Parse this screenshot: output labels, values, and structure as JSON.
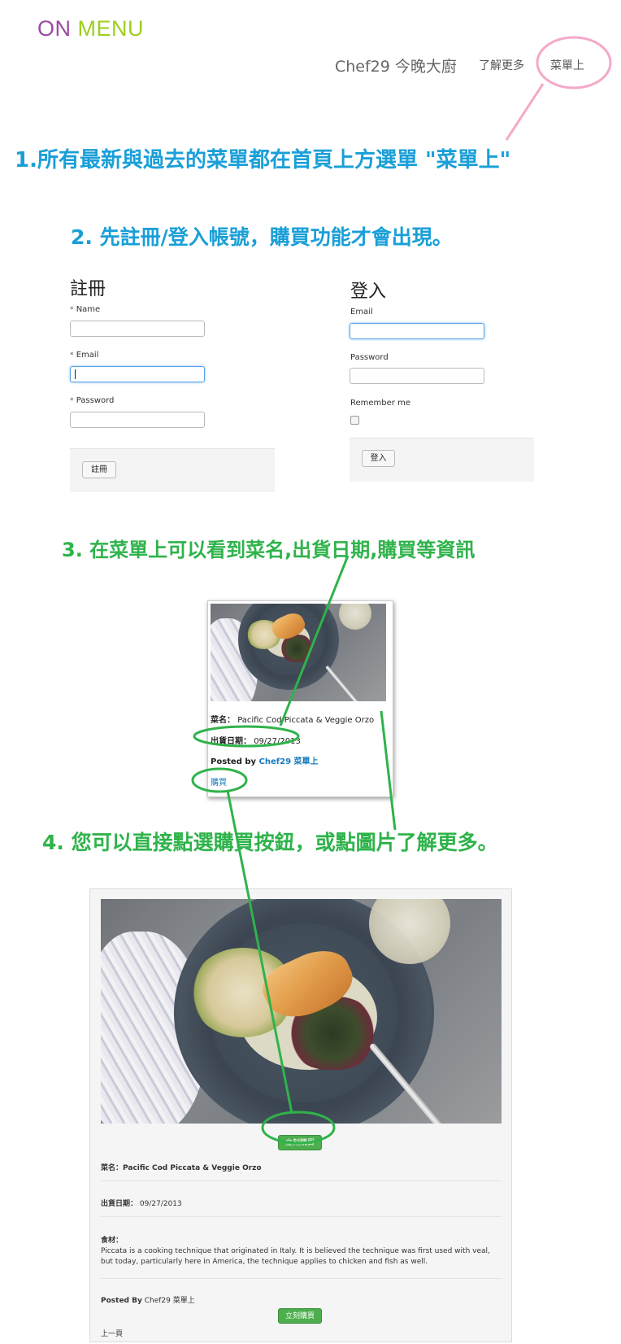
{
  "header": {
    "logo_on": "ON",
    "logo_menu": "MENU",
    "nav_brand": "Chef29 今晚大廚",
    "nav_about": "了解更多",
    "nav_menu": "菜單上"
  },
  "steps": {
    "step1": "1.所有最新與過去的菜單都在首頁上方選單 \"菜單上\"",
    "step2": "2. 先註冊/登入帳號，購買功能才會出現。",
    "step3": "3. 在菜單上可以看到菜名,出貨日期,購買等資訊",
    "step4": "4. 您可以直接點選購買按鈕，或點圖片了解更多。"
  },
  "register": {
    "title": "註冊",
    "name_label": "Name",
    "email_label": "Email",
    "password_label": "Password",
    "required_mark": "*",
    "submit": "註冊"
  },
  "login": {
    "title": "登入",
    "email_label": "Email",
    "password_label": "Password",
    "remember_label": "Remember me",
    "submit": "登入"
  },
  "card": {
    "name_label": "菜名：",
    "name_value": "Pacific Cod Piccata & Veggie Orzo",
    "date_label": "出貨日期：",
    "date_value": "09/27/2013",
    "posted_by": "Posted by",
    "author": "Chef29 菜單上",
    "buy_link": "購買"
  },
  "detail": {
    "buy_now": "立刻購買",
    "name_label": "菜名：",
    "name_value": "Pacific Cod Piccata & Veggie Orzo",
    "date_label": "出貨日期：",
    "date_value": "09/27/2013",
    "ingredients_label": "食材：",
    "description": "Piccata is a cooking technique that originated in Italy. It is believed the technique was first used with veal, but today, particularly here in America, the technique applies to chicken and fish as well.",
    "posted_by": "Posted By",
    "author": "Chef29 菜單上",
    "buy_now_bottom": "立刻購買",
    "prev_page": "上一頁"
  },
  "colors": {
    "logo_on": "#9b4aa3",
    "logo_menu": "#9ccf1d",
    "step_blue": "#1a9fd8",
    "step_green": "#2fb34b",
    "annotation_pink": "#f4a9c8",
    "annotation_green": "#2fb34b",
    "button_green": "#4cae4c"
  }
}
